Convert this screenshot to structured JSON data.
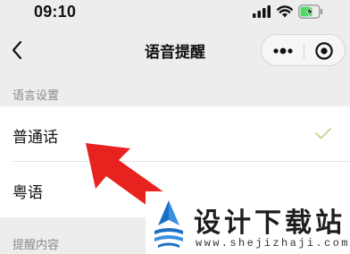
{
  "status_bar": {
    "time": "09:10",
    "icons": [
      "signal-icon",
      "wifi-icon",
      "battery-charging-icon"
    ]
  },
  "nav": {
    "title": "语音提醒",
    "back_icon": "chevron-left-icon",
    "capsule_icons": [
      "more-icon",
      "close-icon"
    ]
  },
  "sections": {
    "language_header": "语言设置",
    "reminder_header": "提醒内容"
  },
  "language_options": [
    {
      "label": "普通话",
      "selected": true
    },
    {
      "label": "粤语",
      "selected": false
    }
  ],
  "colors": {
    "check": "#c7d58a",
    "arrow": "#e8231f",
    "battery_fill": "#4cd964",
    "watermark_logo": "#1a6fc4"
  },
  "watermark": {
    "title": "设计下载站",
    "url": "www.shejizhaji.com"
  }
}
